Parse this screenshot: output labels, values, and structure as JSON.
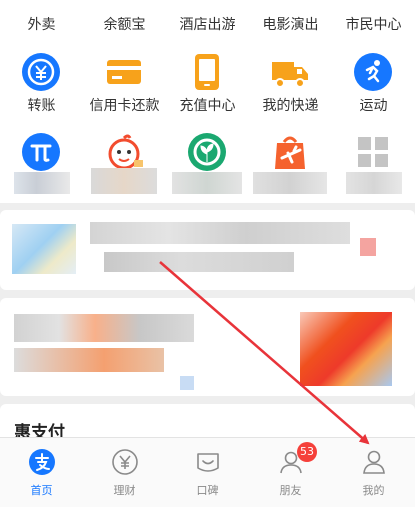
{
  "grid": {
    "row1": [
      {
        "icon": "takeout-icon",
        "label": "外卖"
      },
      {
        "icon": "yuebao-icon",
        "label": "余额宝"
      },
      {
        "icon": "hotel-travel-icon",
        "label": "酒店出游"
      },
      {
        "icon": "movie-show-icon",
        "label": "电影演出"
      },
      {
        "icon": "citizen-center-icon",
        "label": "市民中心"
      }
    ],
    "row2": [
      {
        "icon": "transfer-icon",
        "label": "转账"
      },
      {
        "icon": "credit-card-icon",
        "label": "信用卡还款"
      },
      {
        "icon": "phone-recharge-icon",
        "label": "充值中心"
      },
      {
        "icon": "delivery-truck-icon",
        "label": "我的快递"
      },
      {
        "icon": "sport-runner-icon",
        "label": "运动"
      }
    ],
    "row3": [
      {
        "icon": "pi-icon"
      },
      {
        "icon": "mascot-icon"
      },
      {
        "icon": "leaf-icon"
      },
      {
        "icon": "travel-bag-icon"
      },
      {
        "icon": "more-grid-icon"
      }
    ]
  },
  "hui_section": {
    "title": "惠支付"
  },
  "tabbar": {
    "tabs": [
      {
        "icon": "alipay-home-icon",
        "label": "首页",
        "active": true
      },
      {
        "icon": "yuan-circle-icon",
        "label": "理财"
      },
      {
        "icon": "koubei-icon",
        "label": "口碑"
      },
      {
        "icon": "friends-icon",
        "label": "朋友",
        "badge": "53"
      },
      {
        "icon": "profile-icon",
        "label": "我的"
      }
    ]
  },
  "colors": {
    "accent": "#1677ff",
    "badge": "#f5403a",
    "arrow": "#e8343a"
  }
}
